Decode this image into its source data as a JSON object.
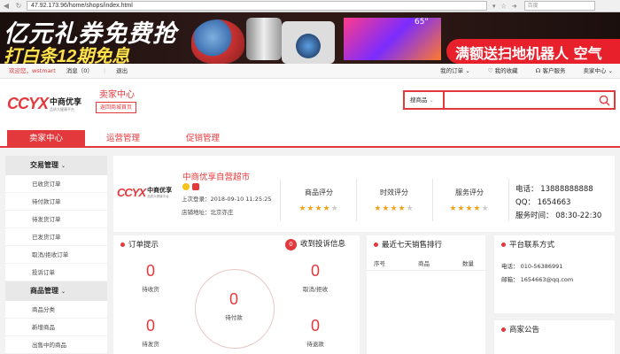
{
  "browser": {
    "url": "47.92.173.96/home/shops/index.html",
    "search_placeholder": "百度"
  },
  "banner": {
    "headline": "亿元礼券免费抢",
    "subline": "打白条12期免息",
    "tv_size": "65\"",
    "cta": "满额送扫地机器人  空气"
  },
  "topbar": {
    "welcome": "欢迎您，wstmart",
    "messages": "消息（0）",
    "logout": "退出",
    "my_orders": "我的订单",
    "favorites": "我的收藏",
    "service": "客户服务",
    "seller_center": "卖家中心"
  },
  "header": {
    "logo_brand": "CCYX",
    "logo_cn": "中商优享",
    "logo_slogan": "品质大健康平台",
    "title": "卖家中心",
    "back_button": "返回商城首页",
    "search_category": "搜商品"
  },
  "mainnav": {
    "tabs": [
      {
        "label": "卖家中心"
      },
      {
        "label": "运营管理"
      },
      {
        "label": "促销管理"
      }
    ]
  },
  "sidebar": {
    "groups": [
      {
        "label": "交易管理",
        "items": [
          "已收货订单",
          "待付款订单",
          "待发货订单",
          "已发货订单",
          "取消/拒收订单",
          "投诉订单"
        ]
      },
      {
        "label": "商品管理",
        "items": [
          "商品分类",
          "新增商品",
          "出售中的商品"
        ]
      }
    ]
  },
  "store": {
    "name": "中商优享自营超市",
    "last_login_label": "上次登录：",
    "last_login": "2018-09-10 11:25:25",
    "address_label": "店铺地址：",
    "address": "北京亦庄",
    "ratings": [
      {
        "label": "商品评分",
        "stars": 4,
        "max": 5
      },
      {
        "label": "时效评分",
        "stars": 4,
        "max": 5
      },
      {
        "label": "服务评分",
        "stars": 4,
        "max": 5
      }
    ],
    "phone": "电话：   13888888888",
    "qq": "QQ：  1654663",
    "hours": "服务时间：  08:30-22:30"
  },
  "order_panel": {
    "title": "订单提示",
    "complaint_count": "0",
    "complaint_title": "收到投诉信息",
    "stats": [
      {
        "value": "0",
        "label": "待收货"
      },
      {
        "value": "0",
        "label": "取消/拒收"
      },
      {
        "value": "0",
        "label": "待付款"
      },
      {
        "value": "0",
        "label": "待发货"
      },
      {
        "value": "0",
        "label": "待退款"
      }
    ]
  },
  "rank_panel": {
    "title": "最近七天销售排行",
    "columns": [
      "序号",
      "商品",
      "数量"
    ]
  },
  "platform_panel": {
    "title": "平台联系方式",
    "phone": "电话：  010-56386991",
    "email": "邮箱：  1654663@qq.com"
  },
  "notice_panel": {
    "title": "商家公告"
  },
  "colors": {
    "accent": "#e4393c",
    "star": "#f4a21a"
  }
}
